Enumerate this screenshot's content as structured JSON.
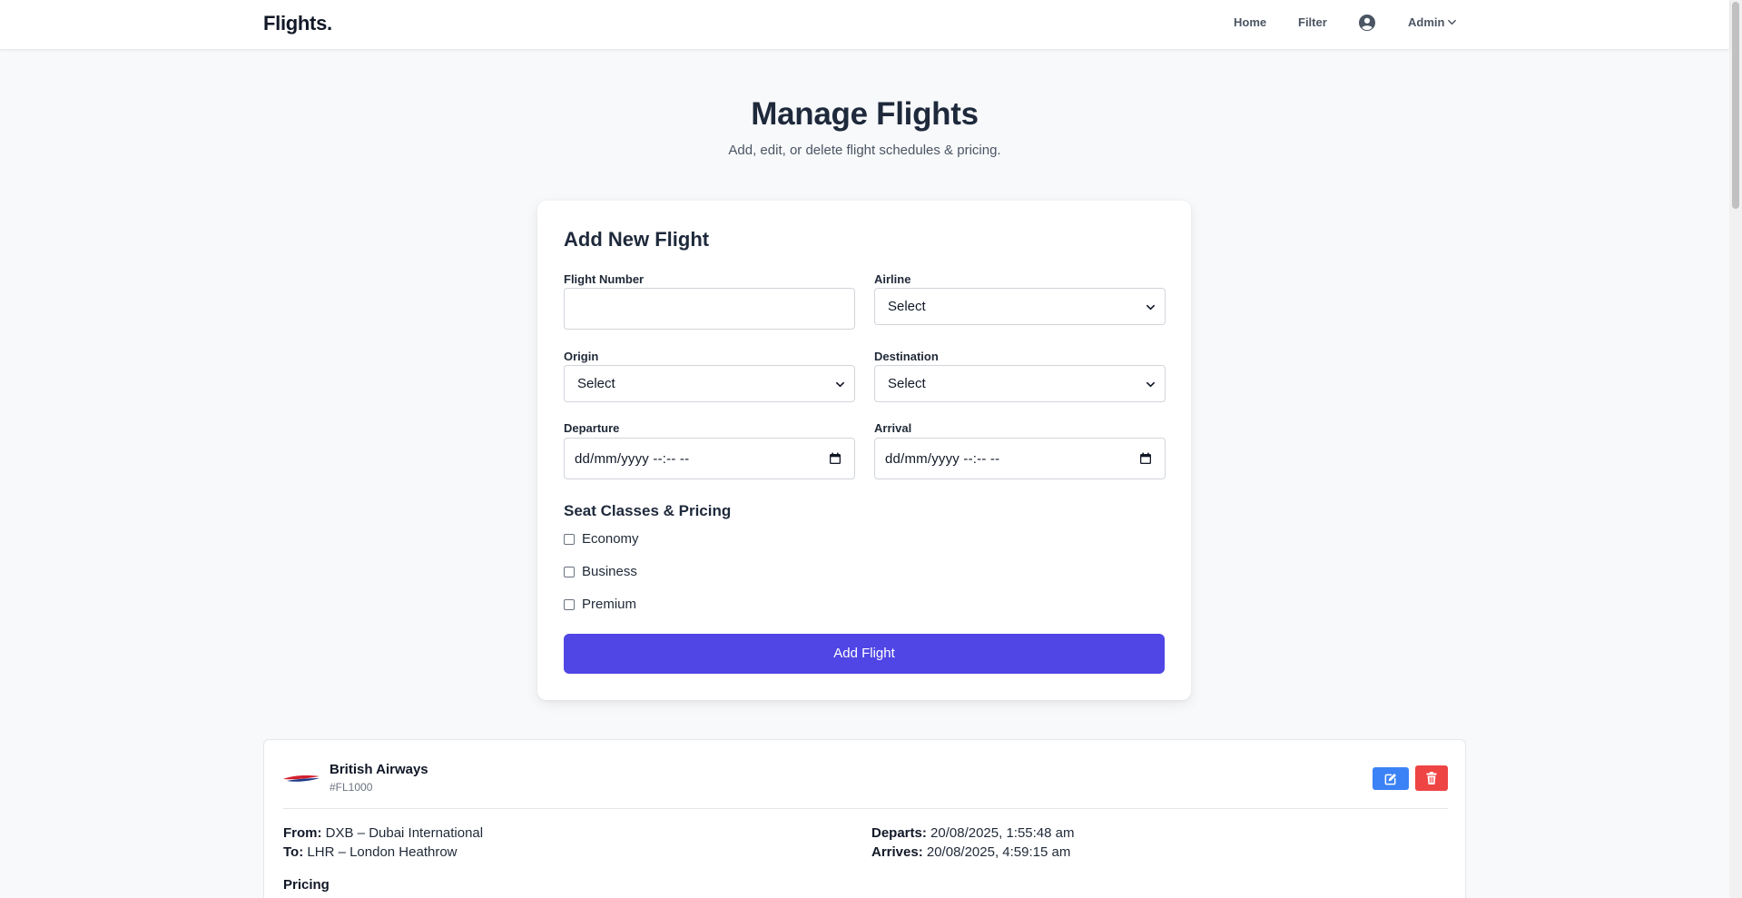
{
  "nav": {
    "brand": "Flights.",
    "home": "Home",
    "filter": "Filter",
    "user_icon": "user-circle-icon",
    "admin": "Admin"
  },
  "header": {
    "title": "Manage Flights",
    "subtitle": "Add, edit, or delete flight schedules & pricing."
  },
  "form": {
    "title": "Add New Flight",
    "flight_number": {
      "label": "Flight Number",
      "value": ""
    },
    "airline": {
      "label": "Airline",
      "value": "Select"
    },
    "origin": {
      "label": "Origin",
      "value": "Select"
    },
    "destination": {
      "label": "Destination",
      "value": "Select"
    },
    "departure": {
      "label": "Departure",
      "value": "dd/mm/yyyy --:-- --"
    },
    "arrival": {
      "label": "Arrival",
      "value": "dd/mm/yyyy --:-- --"
    },
    "seat_section_title": "Seat Classes & Pricing",
    "seat_classes": [
      {
        "label": "Economy",
        "checked": false
      },
      {
        "label": "Business",
        "checked": false
      },
      {
        "label": "Premium",
        "checked": false
      }
    ],
    "submit": "Add Flight"
  },
  "flights": [
    {
      "airline": "British Airways",
      "number": "#FL1000",
      "from_label": "From:",
      "from": "DXB – Dubai International",
      "to_label": "To:",
      "to": "LHR – London Heathrow",
      "departs_label": "Departs:",
      "departs": "20/08/2025, 1:55:48 am",
      "arrives_label": "Arrives:",
      "arrives": "20/08/2025, 4:59:15 am",
      "pricing_title": "Pricing"
    }
  ],
  "colors": {
    "primary": "#4f46e5",
    "edit": "#3b82f6",
    "delete": "#ef4444",
    "background": "#f8f9fb"
  }
}
